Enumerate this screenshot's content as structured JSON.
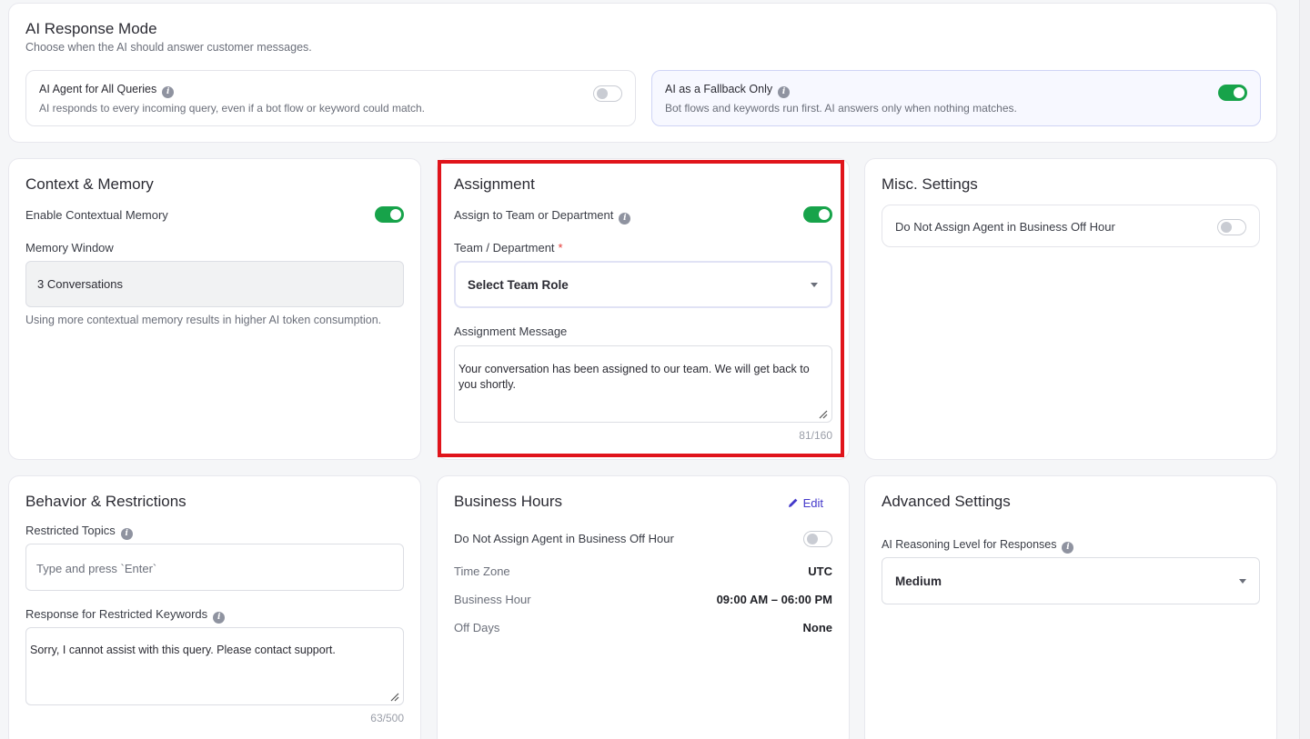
{
  "response_mode": {
    "title": "AI Response Mode",
    "subtitle": "Choose when the AI should answer customer messages.",
    "options": [
      {
        "title": "AI Agent for All Queries",
        "description": "AI responds to every incoming query, even if a bot flow or keyword could match.",
        "enabled": false
      },
      {
        "title": "AI as a Fallback Only",
        "description": "Bot flows and keywords run first. AI answers only when nothing matches.",
        "enabled": true
      }
    ]
  },
  "context_memory": {
    "title": "Context & Memory",
    "toggle_label": "Enable Contextual Memory",
    "toggle_on": true,
    "window_label": "Memory Window",
    "window_value": "3 Conversations",
    "note": "Using more contextual memory results in higher AI token consumption."
  },
  "assignment": {
    "title": "Assignment",
    "toggle_label": "Assign to Team or Department",
    "toggle_on": true,
    "team_label": "Team / Department",
    "required_mark": "*",
    "team_placeholder": "Select Team Role",
    "message_label": "Assignment Message",
    "message_value": "Your conversation has been assigned to our team. We will get back to you shortly.",
    "counter": "81/160"
  },
  "misc": {
    "title": "Misc. Settings",
    "item_label": "Do Not Assign Agent in Business Off Hour",
    "item_on": false
  },
  "behavior": {
    "title": "Behavior & Restrictions",
    "topics_label": "Restricted Topics",
    "topics_placeholder": "Type and press `Enter`",
    "response_label": "Response for Restricted Keywords",
    "response_value": "Sorry, I cannot assist with this query. Please contact support.",
    "counter": "63/500"
  },
  "business_hours": {
    "title": "Business Hours",
    "edit_label": "Edit",
    "toggle_label": "Do Not Assign Agent in Business Off Hour",
    "toggle_on": false,
    "rows": [
      {
        "label": "Time Zone",
        "value": "UTC"
      },
      {
        "label": "Business Hour",
        "value": "09:00 AM – 06:00 PM"
      },
      {
        "label": "Off Days",
        "value": "None"
      }
    ]
  },
  "advanced": {
    "title": "Advanced Settings",
    "reasoning_label": "AI Reasoning Level for Responses",
    "reasoning_value": "Medium"
  },
  "colors": {
    "toggle_on": "#17a34a",
    "highlight": "#e0141b",
    "edit_link": "#4338ca"
  }
}
